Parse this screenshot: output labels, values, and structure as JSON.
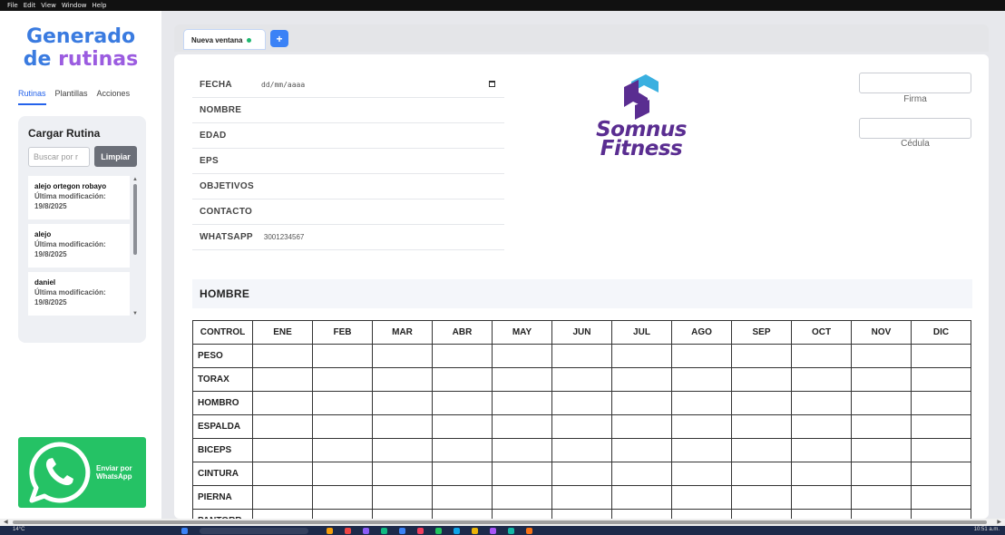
{
  "menubar": [
    "File",
    "Edit",
    "View",
    "Window",
    "Help"
  ],
  "sidebar": {
    "brand": {
      "line1": "Generado",
      "line2a": "de ",
      "line2b": "rutinas"
    },
    "tabs": [
      {
        "label": "Rutinas",
        "active": true
      },
      {
        "label": "Plantillas",
        "active": false
      },
      {
        "label": "Acciones",
        "active": false
      }
    ],
    "load": {
      "title": "Cargar Rutina",
      "search_placeholder": "Buscar por r",
      "clear_label": "Limpiar",
      "routines": [
        {
          "name": "alejo ortegon robayo",
          "modified_label": "Última modificación:",
          "date": "19/8/2025"
        },
        {
          "name": "alejo",
          "modified_label": "Última modificación:",
          "date": "19/8/2025"
        },
        {
          "name": "daniel",
          "modified_label": "Última modificación:",
          "date": "19/8/2025"
        }
      ]
    },
    "whatsapp": {
      "label": "Enviar por WhatsApp",
      "color": "#25c265"
    }
  },
  "tabs": {
    "current": "Nueva ventana",
    "add_label": "+"
  },
  "form": {
    "fields": [
      {
        "label": "FECHA",
        "value": "dd/mm/aaaa"
      },
      {
        "label": "NOMBRE",
        "value": ""
      },
      {
        "label": "EDAD",
        "value": ""
      },
      {
        "label": "EPS",
        "value": ""
      },
      {
        "label": "OBJETIVOS",
        "value": ""
      },
      {
        "label": "CONTACTO",
        "value": ""
      },
      {
        "label": "WHATSAPP",
        "value": "3001234567"
      }
    ],
    "logo": {
      "line1": "Somnus",
      "line2": "Fitness",
      "color": "#5a2d91",
      "accent": "#3ab0e0"
    },
    "firma_label": "Firma",
    "cedula_label": "Cédula"
  },
  "section": {
    "title": "HOMBRE"
  },
  "table": {
    "headers": [
      "CONTROL",
      "ENE",
      "FEB",
      "MAR",
      "ABR",
      "MAY",
      "JUN",
      "JUL",
      "AGO",
      "SEP",
      "OCT",
      "NOV",
      "DIC"
    ],
    "rows": [
      "PESO",
      "TORAX",
      "HOMBRO",
      "ESPALDA",
      "BICEPS",
      "CINTURA",
      "PIERNA",
      "PANTORR"
    ]
  },
  "taskbar": {
    "weather": "14°C",
    "clock": "10:51 a.m."
  }
}
